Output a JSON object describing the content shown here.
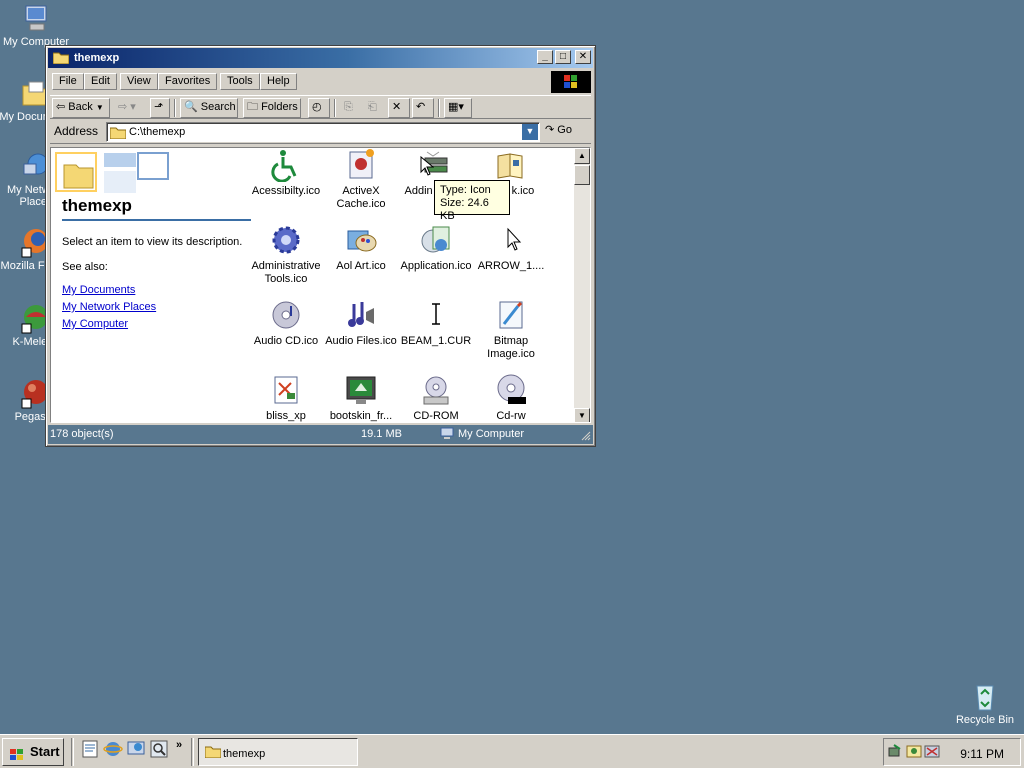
{
  "desktop": {
    "icons": [
      {
        "label": "My Computer"
      },
      {
        "label": "My Documents"
      },
      {
        "label": "My Network Places"
      },
      {
        "label": "Mozilla Firefox"
      },
      {
        "label": "K-Meleon"
      },
      {
        "label": "Pegasus"
      },
      {
        "label": "Recycle Bin"
      }
    ]
  },
  "window": {
    "title": "themexp",
    "controls": {
      "minimize": "_",
      "maximize": "□",
      "close": "✕"
    },
    "menu": [
      "File",
      "Edit",
      "View",
      "Favorites",
      "Tools",
      "Help"
    ],
    "toolbar": {
      "back": "Back",
      "search": "Search",
      "folders": "Folders"
    },
    "address": {
      "label": "Address",
      "value": "C:\\themexp",
      "go": "Go"
    },
    "webpane": {
      "title": "themexp",
      "description": "Select an item to view its description.",
      "see_also": "See also:",
      "links": [
        "My Documents",
        "My Network Places",
        "My Computer"
      ]
    },
    "files": [
      {
        "name": "Acessibilty.ico",
        "icon": "accessibility-icon"
      },
      {
        "name": "ActiveX Cache.ico",
        "icon": "activex-icon"
      },
      {
        "name": "Addin Hardw",
        "icon": "add-hardware-icon"
      },
      {
        "name": "ress k.ico",
        "icon": "address-book-icon"
      },
      {
        "name": "Administrative Tools.ico",
        "icon": "gear-icon"
      },
      {
        "name": "Aol Art.ico",
        "icon": "aol-art-icon"
      },
      {
        "name": "Application.ico",
        "icon": "application-icon"
      },
      {
        "name": "ARROW_1....",
        "icon": "arrow-cursor-icon"
      },
      {
        "name": "Audio CD.ico",
        "icon": "audio-cd-icon"
      },
      {
        "name": "Audio Files.ico",
        "icon": "audio-files-icon"
      },
      {
        "name": "BEAM_1.CUR",
        "icon": "beam-cursor-icon"
      },
      {
        "name": "Bitmap Image.ico",
        "icon": "bitmap-icon"
      },
      {
        "name": "bliss_xp",
        "icon": "bliss-icon"
      },
      {
        "name": "bootskin_fr...",
        "icon": "bootskin-icon"
      },
      {
        "name": "CD-ROM",
        "icon": "cd-rom-icon"
      },
      {
        "name": "Cd-rw",
        "icon": "cd-rw-icon"
      }
    ],
    "tooltip": {
      "type": "Type: Icon",
      "size": "Size: 24.6 KB"
    },
    "status": {
      "objects": "178 object(s)",
      "size": "19.1 MB",
      "zone": "My Computer"
    }
  },
  "taskbar": {
    "start": "Start",
    "task": "themexp",
    "clock": "9:11 PM"
  }
}
